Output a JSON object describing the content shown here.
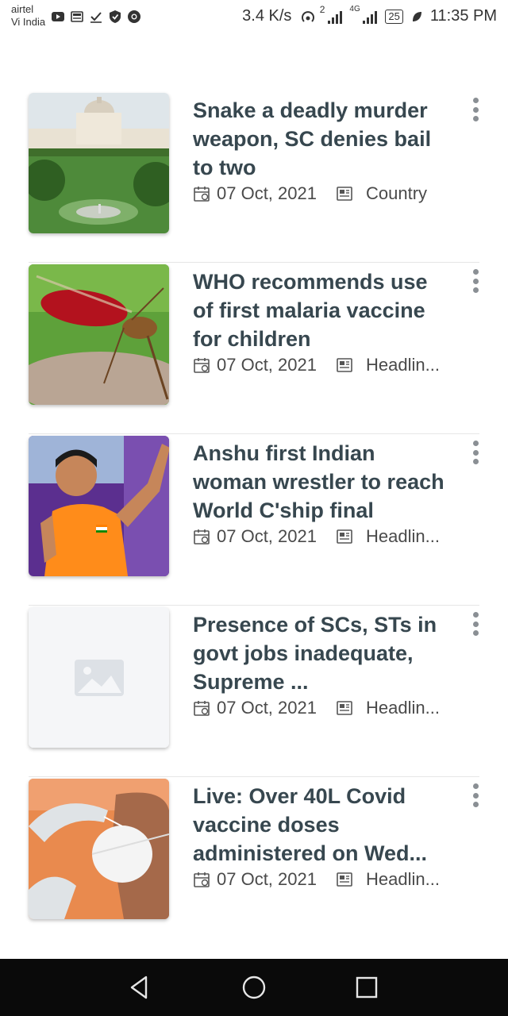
{
  "status_bar": {
    "carrier_1": "airtel",
    "carrier_2": "Vi India",
    "left_icons": [
      "youtube-icon",
      "news-icon",
      "check-icon",
      "shield-icon",
      "chrome-icon"
    ],
    "speed": "3.4 K/s",
    "hotspot_badge": "2",
    "network_label": "4G",
    "battery": "25",
    "time": "11:35 PM"
  },
  "articles": [
    {
      "title": "Snake a deadly murder weapon, SC denies bail to two",
      "date": "07 Oct, 2021",
      "category": "Country",
      "image": "supreme-court-building"
    },
    {
      "title": "WHO recommends use of first malaria vaccine for children",
      "date": "07 Oct, 2021",
      "category": "Headlin...",
      "image": "mosquito-closeup"
    },
    {
      "title": "Anshu first Indian woman wrestler to reach World C'ship final",
      "date": "07 Oct, 2021",
      "category": "Headlin...",
      "image": "wrestler-celebrating"
    },
    {
      "title": "Presence of SCs, STs in govt jobs inadequate, Supreme ...",
      "date": "07 Oct, 2021",
      "category": "Headlin...",
      "image": "placeholder-image"
    },
    {
      "title": "Live: Over 40L Covid vaccine doses administered on Wed...",
      "date": "07 Oct, 2021",
      "category": "Headlin...",
      "image": "covid-swab-test"
    }
  ],
  "colors": {
    "title": "#37474f",
    "meta": "#4a4a4a",
    "divider": "#e6e6e6",
    "navbar": "#0a0a0a"
  }
}
